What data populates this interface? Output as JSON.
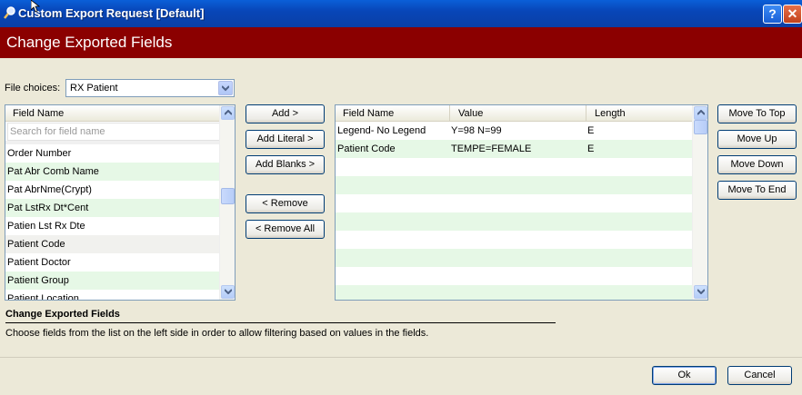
{
  "window": {
    "title": "Custom Export Request [Default]",
    "help_label": "?",
    "close_label": "✕",
    "icon": "search-magnifier-icon"
  },
  "header": {
    "title": "Change Exported Fields"
  },
  "file_choices": {
    "label": "File choices:",
    "value": "RX Patient"
  },
  "left_list": {
    "column": "Field Name",
    "search_placeholder": "Search for field name",
    "items": [
      "Order Number",
      "Pat Abr Comb Name",
      "Pat AbrNme(Crypt)",
      "Pat LstRx Dt*Cent",
      "Patien Lst Rx Dte",
      "Patient Code",
      "Patient Doctor",
      "Patient Group",
      "Patient Location"
    ]
  },
  "middle_buttons": {
    "add": "Add >",
    "add_literal": "Add Literal >",
    "add_blanks": "Add Blanks >",
    "remove": "< Remove",
    "remove_all": "< Remove All"
  },
  "right_table": {
    "columns": [
      "Field Name",
      "Value",
      "Length"
    ],
    "rows": [
      {
        "field": "Legend- No Legend",
        "value": "Y=98 N=99",
        "length": "E"
      },
      {
        "field": "Patient Code",
        "value": "TEMPE=FEMALE",
        "length": "E"
      }
    ]
  },
  "move_buttons": {
    "top": "Move To Top",
    "up": "Move Up",
    "down": "Move Down",
    "end": "Move To End"
  },
  "help": {
    "title": "Change Exported Fields",
    "text": "Choose fields from the list on the left side in order to allow filtering based on values in the fields."
  },
  "footer": {
    "ok": "Ok",
    "cancel": "Cancel"
  }
}
